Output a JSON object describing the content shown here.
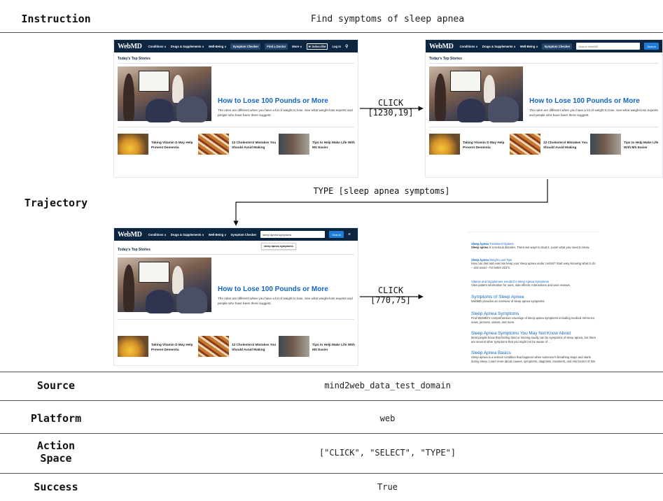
{
  "instruction": {
    "label": "Instruction",
    "value": "Find symptoms of sleep apnea"
  },
  "trajectory": {
    "label": "Trajectory",
    "actions": [
      {
        "op": "CLICK",
        "arg": "[1230,19]"
      },
      {
        "op": "TYPE",
        "arg": "[sleep apnea symptoms]"
      },
      {
        "op": "CLICK",
        "arg": "[770,75]"
      }
    ]
  },
  "webmd": {
    "logo": "WebMD",
    "nav": {
      "conditions": "Conditions ∨",
      "drugs": "Drugs & Supplements ∨",
      "wellbeing": "Well-Being ∨",
      "symptom_checker": "Symptom Checker",
      "find_doctor": "Find a Doctor",
      "more": "More ∨",
      "subscribe": "Subscribe",
      "login": "Log In"
    },
    "search_placeholder": "Search WebMD",
    "search_button": "Search",
    "search_typed": "sleep apnea symptoms",
    "suggestion": "sleep apnea symptoms",
    "top_stories": "Today's Top Stories",
    "hero": {
      "title": "How to Lose 100 Pounds or More",
      "summary": "The rules are different when you have a lot of weight to lose. See what weight-loss experts and people who have been there suggest."
    },
    "cards": [
      {
        "text": "Taking Vitamin D May Help Prevent Dementia"
      },
      {
        "text": "12 Cholesterol Mistakes You Should Avoid Making"
      },
      {
        "text": "Tips to Help Make Life With MS Easier"
      }
    ]
  },
  "results": [
    {
      "title_bold": "Sleep Apnea",
      "title_rest": " Treatment Options",
      "desc_bold": "Sleep apnea",
      "desc_rest": " is a serious disorder. There are ways to treat it. Learn what you need to know."
    },
    {
      "title_bold": "Sleep Apnea",
      "title_rest": " Weight Loss Tips",
      "desc_bold": "",
      "desc_rest": "How can diet and exercise keep your sleep apnea under control? Start easy knowing what to do – and avoid – for better ZZZ's."
    },
    {
      "title_bold": "",
      "title_rest": "Vitamin and Supplement results for Sleep Apnea Symptoms",
      "desc_bold": "",
      "desc_rest": "View patient information for uses, side effects, interactions and user reviews."
    },
    {
      "title_bold": "",
      "title_rest": "Symptoms of Sleep Apnea",
      "desc_bold": "",
      "desc_rest": "WebMD provides an overview of sleep apnea symptoms."
    },
    {
      "title_bold": "",
      "title_rest": "Sleep Apnea Symptoms",
      "desc_bold": "",
      "desc_rest": "Find WebMD's comprehensive coverage of sleep apnea symptoms including medical reference, news, pictures, videos, and more."
    },
    {
      "title_bold": "",
      "title_rest": "Sleep Apnea Symptoms You May Not Know About",
      "desc_bold": "",
      "desc_rest": "Most people know that feeling tired or snoring loudly can be symptoms of sleep apnea, but there are several other symptoms that you might not be aware of ..."
    },
    {
      "title_bold": "",
      "title_rest": "Sleep Apnea Basics",
      "desc_bold": "",
      "desc_rest": "Sleep apnea is a serious condition that happens when someone's breathing stops and starts during sleep. Learn more about causes, symptoms, diagnosis, treatment, and risk factors of this"
    }
  ],
  "source": {
    "label": "Source",
    "value": "mind2web_data_test_domain"
  },
  "platform": {
    "label": "Platform",
    "value": "web"
  },
  "action_space": {
    "label": "Action Space",
    "value": "[\"CLICK\", \"SELECT\", \"TYPE\"]"
  },
  "success": {
    "label": "Success",
    "value": "True"
  }
}
